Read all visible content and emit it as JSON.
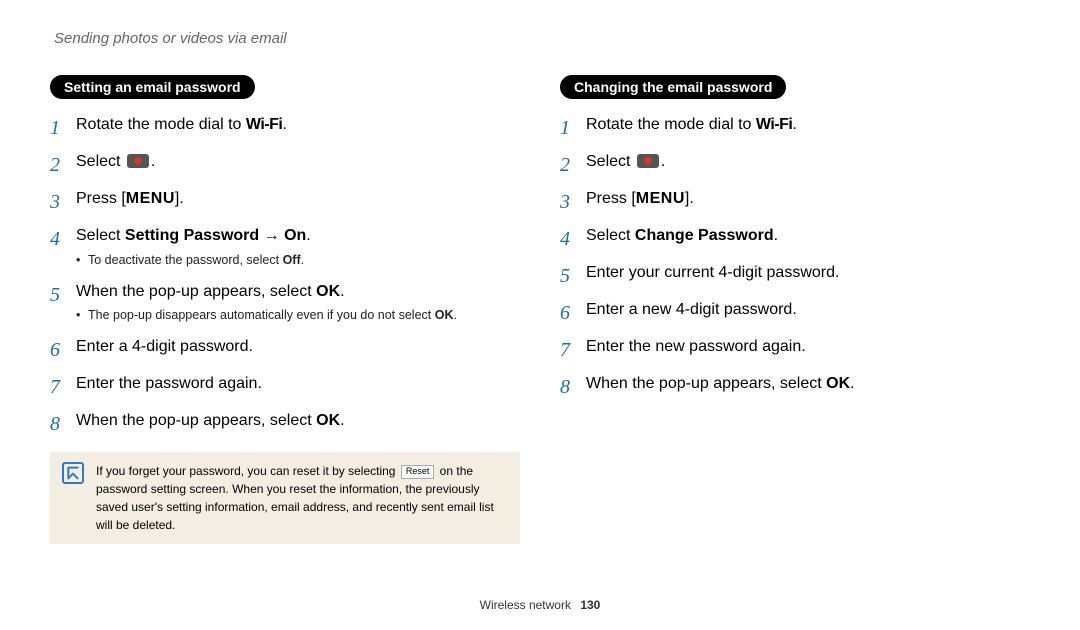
{
  "page_title": "Sending photos or videos via email",
  "left": {
    "heading": "Setting an email password",
    "steps": {
      "s1": {
        "pre": "Rotate the mode dial to ",
        "wifi": "Wi-Fi",
        "post": "."
      },
      "s2": {
        "pre": "Select ",
        "post": "."
      },
      "s3": {
        "pre": "Press [",
        "menu": "MENU",
        "post": "]."
      },
      "s4": {
        "pre": "Select ",
        "bold": "Setting Password → On",
        "post": ".",
        "sub1_pre": "To deactivate the password, select ",
        "sub1_bold": "Off",
        "sub1_post": "."
      },
      "s5": {
        "pre": "When the pop-up appears, select ",
        "bold": "OK",
        "post": ".",
        "sub1_pre": "The pop-up disappears automatically even if you do not select ",
        "sub1_bold": "OK",
        "sub1_post": "."
      },
      "s6": {
        "text": "Enter a 4-digit password."
      },
      "s7": {
        "text": "Enter the password again."
      },
      "s8": {
        "pre": "When the pop-up appears, select ",
        "bold": "OK",
        "post": "."
      }
    },
    "note": {
      "p1_a": "If you forget your password, you can reset it by selecting ",
      "reset_label": "Reset",
      "p1_b": " on the password setting screen. When you reset the information, the previously saved user's setting information, email address, and recently sent email list will be deleted."
    }
  },
  "right": {
    "heading": "Changing the email password",
    "steps": {
      "s1": {
        "pre": "Rotate the mode dial to ",
        "wifi": "Wi-Fi",
        "post": "."
      },
      "s2": {
        "pre": "Select ",
        "post": "."
      },
      "s3": {
        "pre": "Press [",
        "menu": "MENU",
        "post": "]."
      },
      "s4": {
        "pre": "Select ",
        "bold": "Change Password",
        "post": "."
      },
      "s5": {
        "text": "Enter your current 4-digit password."
      },
      "s6": {
        "text": "Enter a new 4-digit password."
      },
      "s7": {
        "text": "Enter the new password again."
      },
      "s8": {
        "pre": "When the pop-up appears, select ",
        "bold": "OK",
        "post": "."
      }
    }
  },
  "footer": {
    "section": "Wireless network",
    "page": "130"
  },
  "nums": {
    "n1": "1",
    "n2": "2",
    "n3": "3",
    "n4": "4",
    "n5": "5",
    "n6": "6",
    "n7": "7",
    "n8": "8"
  }
}
